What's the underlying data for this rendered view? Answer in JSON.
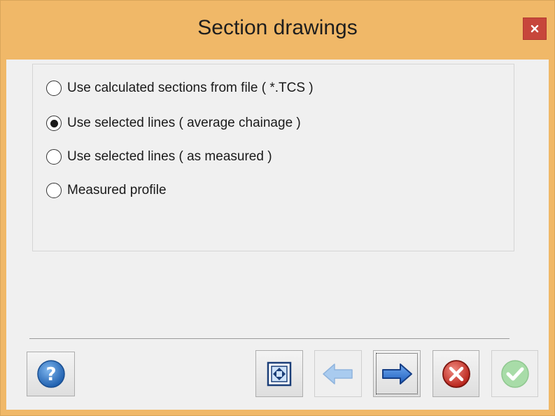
{
  "window": {
    "title": "Section drawings",
    "close_label": "×"
  },
  "options": [
    {
      "label": "Use calculated sections from file ( *.TCS )",
      "selected": false
    },
    {
      "label": "Use selected lines ( average chainage )",
      "selected": true
    },
    {
      "label": "Use selected lines ( as measured )",
      "selected": false
    },
    {
      "label": "Measured profile",
      "selected": false
    }
  ],
  "buttons": {
    "help": {
      "icon": "help-icon",
      "enabled": true
    },
    "fit": {
      "icon": "fit-extent-icon",
      "enabled": true
    },
    "back": {
      "icon": "arrow-left-icon",
      "enabled": false
    },
    "next": {
      "icon": "arrow-right-icon",
      "enabled": true,
      "focused": true
    },
    "cancel": {
      "icon": "cancel-icon",
      "enabled": true
    },
    "finish": {
      "icon": "check-icon",
      "enabled": false
    }
  },
  "colors": {
    "titlebar": "#f0b868",
    "close": "#c7463b",
    "client": "#f0f0f0"
  }
}
